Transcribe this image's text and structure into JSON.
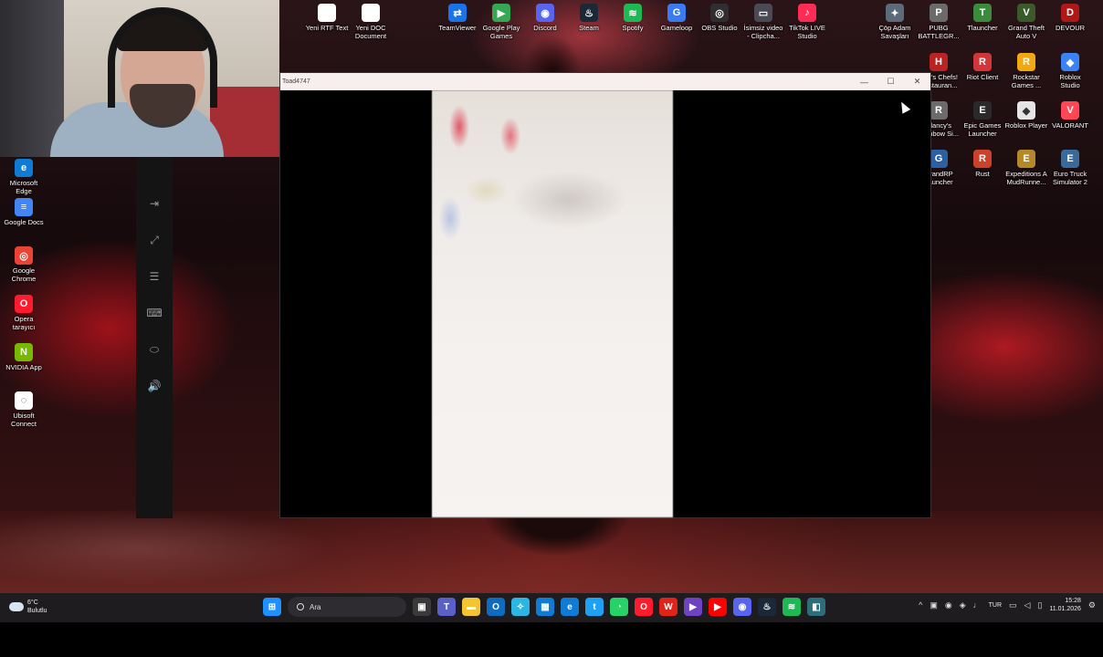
{
  "window": {
    "title": "Toad4747",
    "minimize_label": "—",
    "maximize_label": "☐",
    "close_label": "✕"
  },
  "desktop_icons_top": [
    {
      "label": "Yeni RTF Text",
      "color": "#ffffff",
      "glyph": ""
    },
    {
      "label": "Yeni DOC\nDocument",
      "color": "#ffffff",
      "glyph": ""
    },
    {
      "label": "TeamViewer",
      "color": "#1a73e8",
      "glyph": "⇄"
    },
    {
      "label": "Google Play\nGames",
      "color": "#34a853",
      "glyph": "▶"
    },
    {
      "label": "Discord",
      "color": "#5865f2",
      "glyph": "◉"
    },
    {
      "label": "Steam",
      "color": "#1b2838",
      "glyph": "♨"
    },
    {
      "label": "Spotify",
      "color": "#1db954",
      "glyph": "≋"
    },
    {
      "label": "Gameloop",
      "color": "#3b7bf2",
      "glyph": "G"
    },
    {
      "label": "OBS Studio",
      "color": "#302e31",
      "glyph": "◎"
    },
    {
      "label": "İsimsiz video\n- Clipcha...",
      "color": "#4a4a55",
      "glyph": "▭"
    },
    {
      "label": "TikTok LIVE\nStudio",
      "color": "#fe2c55",
      "glyph": "♪"
    },
    {
      "label": "Çöp Adam\nSavaşları",
      "color": "#5b6b7a",
      "glyph": "✦"
    },
    {
      "label": "PUBG\nBATTLEGR...",
      "color": "#6b6b6b",
      "glyph": "P"
    },
    {
      "label": "Tlauncher",
      "color": "#3c8a3c",
      "glyph": "T"
    },
    {
      "label": "Grand Theft\nAuto V",
      "color": "#3a5a2a",
      "glyph": "V"
    },
    {
      "label": "DEVOUR",
      "color": "#b01818",
      "glyph": "D"
    }
  ],
  "desktop_icons_right": [
    {
      "label": "Hell's Chefs!\nRestauran...",
      "color": "#b22",
      "glyph": "H"
    },
    {
      "label": "Riot Client",
      "color": "#d13639",
      "glyph": "R"
    },
    {
      "label": "Rockstar\nGames ...",
      "color": "#f3a712",
      "glyph": "R"
    },
    {
      "label": "Roblox\nStudio",
      "color": "#3b82f6",
      "glyph": "◆"
    },
    {
      "label": "Clancy's\nRainbow Si...",
      "color": "#6b6b6b",
      "glyph": "R"
    },
    {
      "label": "Epic Games\nLauncher",
      "color": "#2a2a2a",
      "glyph": "E"
    },
    {
      "label": "Roblox Player",
      "color": "#e5e5e5",
      "glyph": "◆"
    },
    {
      "label": "VALORANT",
      "color": "#ff4655",
      "glyph": "V"
    },
    {
      "label": "GrandRP\nLauncher",
      "color": "#2d5fa3",
      "glyph": "G"
    },
    {
      "label": "Rust",
      "color": "#cd412b",
      "glyph": "R"
    },
    {
      "label": "Expeditions A\nMudRunne...",
      "color": "#b5892a",
      "glyph": "E"
    },
    {
      "label": "Euro Truck\nSimulator 2",
      "color": "#3a6a9a",
      "glyph": "E"
    }
  ],
  "desktop_icons_left": [
    {
      "label": "Microsoft\nEdge",
      "color": "#0f7bd4",
      "glyph": "e"
    },
    {
      "label": "Google Docs",
      "color": "#4285f4",
      "glyph": "≡"
    },
    {
      "label": "Google\nChrome",
      "color": "#ea4335",
      "glyph": "◎"
    },
    {
      "label": "Opera\ntarayıcı",
      "color": "#ff1b2d",
      "glyph": "O"
    },
    {
      "label": "NVIDIA App",
      "color": "#76b900",
      "glyph": "N"
    },
    {
      "label": "Ubisoft\nConnect",
      "color": "#ffffff",
      "glyph": "◌"
    }
  ],
  "side_panel": [
    {
      "name": "exit-icon",
      "glyph": "⇥"
    },
    {
      "name": "fullscreen-icon",
      "glyph": "⤢"
    },
    {
      "name": "settings-sliders-icon",
      "glyph": "☰"
    },
    {
      "name": "keyboard-icon",
      "glyph": "⌨"
    },
    {
      "name": "tag-icon",
      "glyph": "⬭"
    },
    {
      "name": "volume-icon",
      "glyph": "🔊"
    }
  ],
  "taskbar": {
    "weather_temp": "6°C",
    "weather_desc": "Bulutlu",
    "search_placeholder": "Ara",
    "language": "TUR",
    "time": "15:28",
    "date": "11.01.2026",
    "apps": [
      {
        "name": "task-view-icon",
        "color": "#3a3a3a",
        "glyph": "▣"
      },
      {
        "name": "teams-icon",
        "color": "#5b5fc7",
        "glyph": "T"
      },
      {
        "name": "file-explorer-icon",
        "color": "#f4c531",
        "glyph": "▬"
      },
      {
        "name": "outlook-icon",
        "color": "#0f6cbd",
        "glyph": "O"
      },
      {
        "name": "copilot-icon",
        "color": "#2bb6e4",
        "glyph": "✧"
      },
      {
        "name": "ms-store-icon",
        "color": "#0f7bd4",
        "glyph": "▦"
      },
      {
        "name": "edge-icon",
        "color": "#0f7bd4",
        "glyph": "e"
      },
      {
        "name": "twitter-icon",
        "color": "#1da1f2",
        "glyph": "t"
      },
      {
        "name": "whatsapp-icon",
        "color": "#25d366",
        "glyph": "◔"
      },
      {
        "name": "opera-icon",
        "color": "#ff1b2d",
        "glyph": "O"
      },
      {
        "name": "wps-icon",
        "color": "#e2231a",
        "glyph": "W"
      },
      {
        "name": "clipchamp-icon",
        "color": "#6f42c1",
        "glyph": "▶"
      },
      {
        "name": "youtube-icon",
        "color": "#ff0000",
        "glyph": "▶"
      },
      {
        "name": "discord-icon",
        "color": "#5865f2",
        "glyph": "◉"
      },
      {
        "name": "steam-icon",
        "color": "#1b2838",
        "glyph": "♨"
      },
      {
        "name": "spotify-icon",
        "color": "#1db954",
        "glyph": "≋"
      },
      {
        "name": "scrcpy-icon",
        "color": "#2d6d7c",
        "glyph": "◧"
      }
    ]
  }
}
